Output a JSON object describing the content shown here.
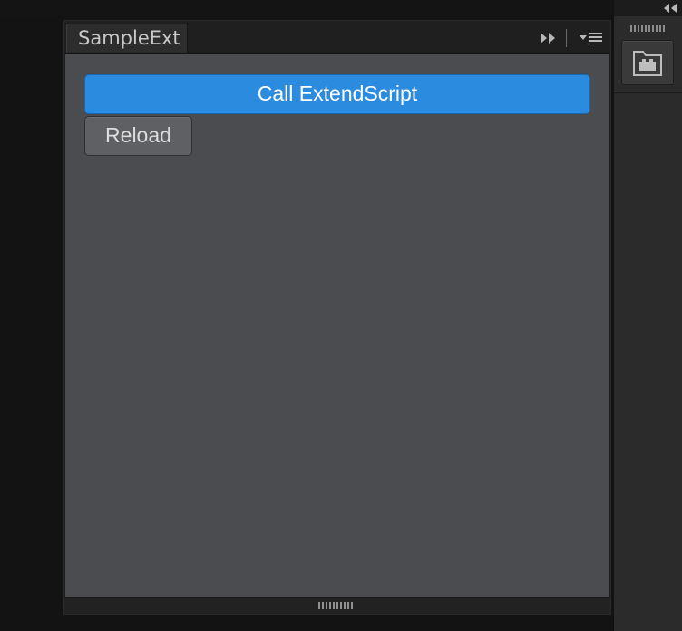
{
  "panel": {
    "tab_label": "SampleExt"
  },
  "buttons": {
    "call_extendscript": "Call ExtendScript",
    "reload": "Reload"
  },
  "icons": {
    "expand": "double-chevron-right-icon",
    "menu": "panel-menu-icon",
    "collapse_dock": "double-chevron-left-icon",
    "extension": "extension-folder-icon"
  },
  "colors": {
    "primary_button": "#2b8bdf",
    "panel_body": "#4b4c4f",
    "secondary_button": "#5f6063"
  }
}
